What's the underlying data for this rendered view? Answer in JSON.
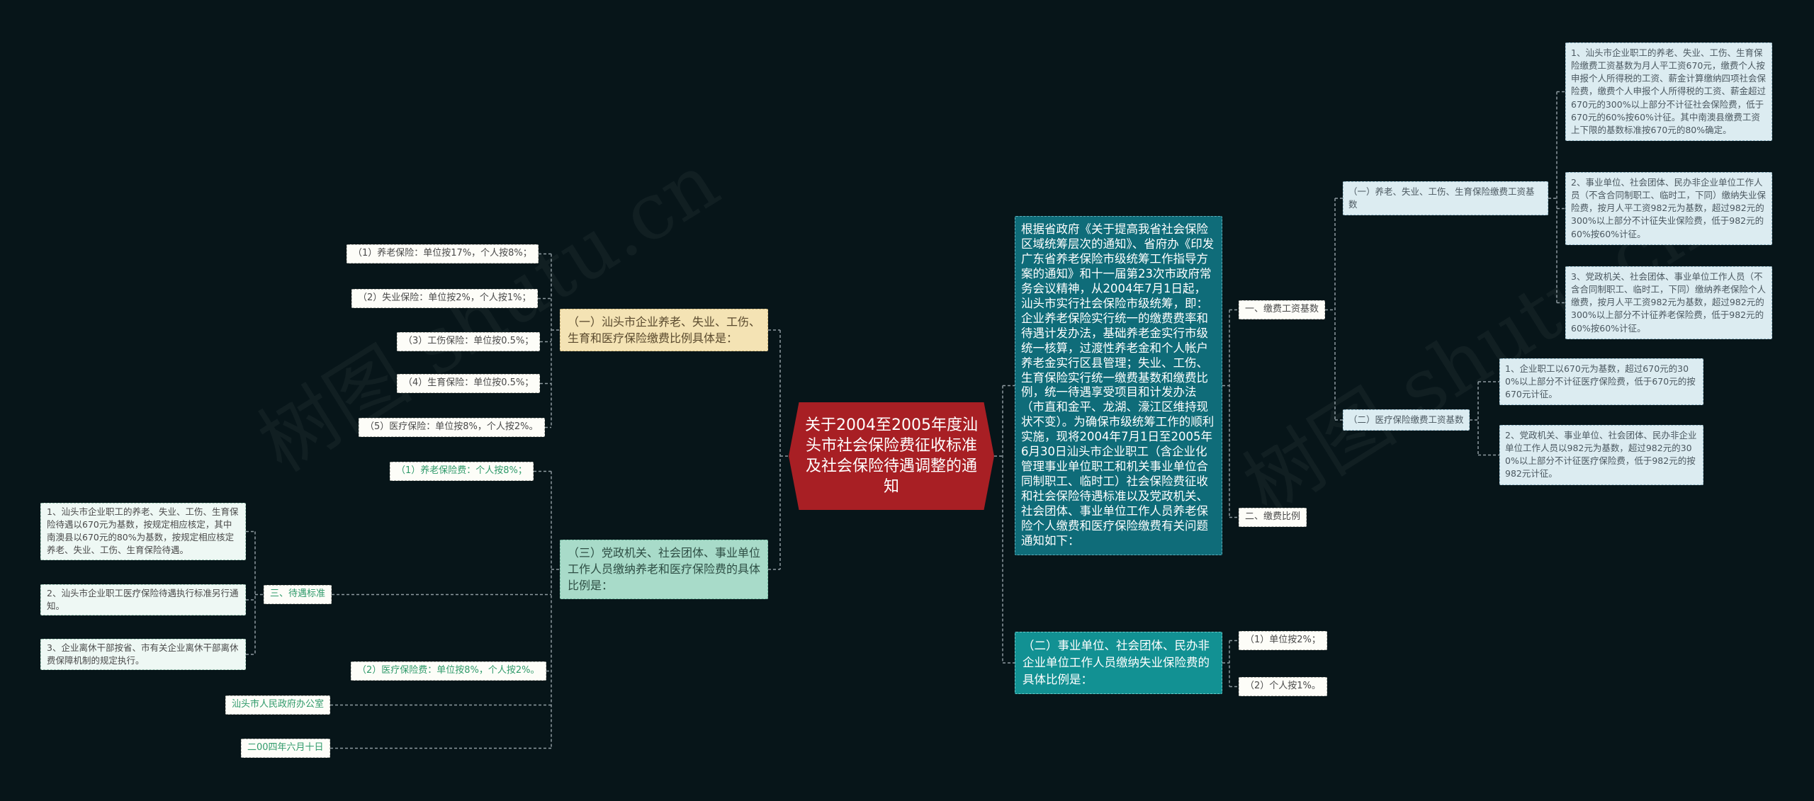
{
  "watermarks": [
    "树图 shutu.cn",
    "树图 shutu.cn"
  ],
  "center": "关于2004至2005年度汕头市社会保险费征收标准及社会保险待遇调整的通知",
  "left": {
    "cat1": {
      "label": "（一）汕头市企业养老、失业、工伤、生育和医疗保险缴费比例具体是：",
      "items": [
        "（1）养老保险：单位按17%，个人按8%；",
        "（2）失业保险：单位按2%，个人按1%；",
        "（3）工伤保险：单位按0.5%；",
        "（4）生育保险：单位按0.5%；",
        "（5）医疗保险：单位按8%，个人按2%。"
      ]
    },
    "cat3": {
      "label": "（三）党政机关、社会团体、事业单位工作人员缴纳养老和医疗保险费的具体比例是：",
      "items": [
        "（1）养老保险费：个人按8%；",
        "（2）医疗保险费：单位按8%，个人按2%。"
      ]
    },
    "treatment": {
      "label": "三、待遇标准",
      "items": [
        "1、汕头市企业职工的养老、失业、工伤、生育保险待遇以670元为基数，按规定相应核定，其中南澳县以670元的80%为基数，按规定相应核定养老、失业、工伤、生育保险待遇。",
        "2、汕头市企业职工医疗保险待遇执行标准另行通知。",
        "3、企业离休干部按省、市有关企业离休干部离休费保障机制的规定执行。"
      ]
    },
    "office": "汕头市人民政府办公室",
    "date": "二00四年六月十日"
  },
  "right": {
    "intro": "根据省政府《关于提高我省社会保险区域统筹层次的通知》、省府办《印发广东省养老保险市级统筹工作指导方案的通知》和十一届第23次市政府常务会议精神，从2004年7月1日起，汕头市实行社会保险市级统筹，即：企业养老保险实行统一的缴费费率和待遇计发办法，基础养老金实行市级统一核算，过渡性养老金和个人帐户养老金实行区县管理；失业、工伤、生育保险实行统一缴费基数和缴费比例，统一待遇享受项目和计发办法（市直和金平、龙湖、濠江区维持现状不变）。为确保市级统筹工作的顺利实施，现将2004年7月1日至2005年6月30日汕头市企业职工（含企业化管理事业单位职工和机关事业单位合同制职工、临时工）社会保险费征收和社会保险待遇标准以及党政机关、社会团体、事业单位工作人员养老保险个人缴费和医疗保险缴费有关问题通知如下：",
    "base": {
      "label": "一、缴费工资基数",
      "sub1": {
        "label": "（一）养老、失业、工伤、生育保险缴费工资基数",
        "items": [
          "1、汕头市企业职工的养老、失业、工伤、生育保险缴费工资基数为月人平工资670元，缴费个人按申报个人所得税的工资、薪金计算缴纳四项社会保险费，缴费个人申报个人所得税的工资、薪金超过670元的300%以上部分不计征社会保险费，低于670元的60%按60%计征。其中南澳县缴费工资上下限的基数标准按670元的80%确定。",
          "2、事业单位、社会团体、民办非企业单位工作人员（不含合同制职工、临时工，下同）缴纳失业保险费，按月人平工资982元为基数，超过982元的300%以上部分不计征失业保险费，低于982元的60%按60%计征。",
          "3、党政机关、社会团体、事业单位工作人员（不含合同制职工、临时工，下同）缴纳养老保险个人缴费，按月人平工资982元为基数，超过982元的300%以上部分不计征养老保险费，低于982元的60%按60%计征。"
        ]
      },
      "sub2": {
        "label": "（二）医疗保险缴费工资基数",
        "items": [
          "1、企业职工以670元为基数，超过670元的300%以上部分不计征医疗保险费，低于670元的按670元计征。",
          "2、党政机关、事业单位、社会团体、民办非企业单位工作人员以982元为基数，超过982元的300%以上部分不计征医疗保险费，低于982元的按982元计征。"
        ]
      }
    },
    "ratio": {
      "label": "二、缴费比例"
    },
    "cat2": {
      "label": "（二）事业单位、社会团体、民办非企业单位工作人员缴纳失业保险费的具体比例是：",
      "items": [
        "（1）单位按2%；",
        "（2）个人按1%。"
      ]
    }
  },
  "colors": {
    "background": "#071519",
    "center": "#a81f24",
    "yellow": "#f4e3b4",
    "mint": "#a8dbc9",
    "teal": "#0f6c79",
    "teal2": "#129193",
    "line": "#8e9aa0"
  }
}
